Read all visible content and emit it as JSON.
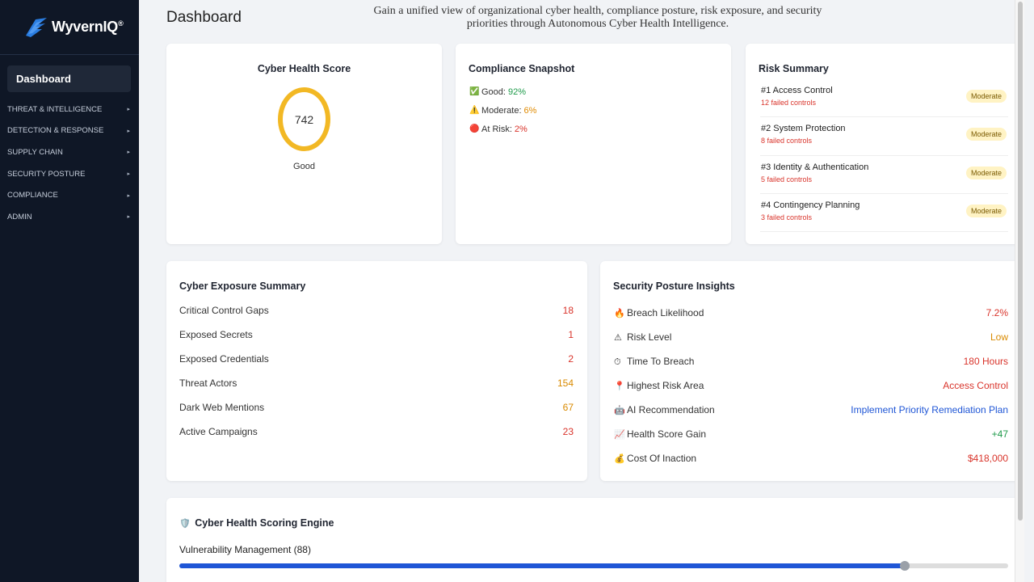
{
  "brand": {
    "name": "WyvernIQ",
    "reg": "®"
  },
  "sidebar": {
    "active": "Dashboard",
    "items": [
      {
        "label": "THREAT & INTELLIGENCE"
      },
      {
        "label": "DETECTION & RESPONSE"
      },
      {
        "label": "SUPPLY CHAIN"
      },
      {
        "label": "SECURITY POSTURE"
      },
      {
        "label": "COMPLIANCE"
      },
      {
        "label": "ADMIN"
      }
    ],
    "caret": "▸"
  },
  "header": {
    "title": "Dashboard",
    "tagline": "Gain a unified view of organizational cyber health, compliance posture, risk exposure, and security priorities through Autonomous Cyber Health Intelligence."
  },
  "health": {
    "title": "Cyber Health Score",
    "score": "742",
    "label": "Good",
    "ring_color": "#f2b824"
  },
  "compliance": {
    "title": "Compliance Snapshot",
    "rows": [
      {
        "icon": "✅",
        "label": "Good:",
        "value": "92%",
        "color": "#1e9a4a"
      },
      {
        "icon": "⚠️",
        "label": "Moderate:",
        "value": "6%",
        "color": "#e08a00"
      },
      {
        "icon": "🔴",
        "label": "At Risk:",
        "value": "2%",
        "color": "#d9342b"
      }
    ]
  },
  "risk": {
    "title": "Risk Summary",
    "items": [
      {
        "title": "#1 Access Control",
        "sub": "12 failed controls",
        "badge": "Moderate"
      },
      {
        "title": "#2 System Protection",
        "sub": "8 failed controls",
        "badge": "Moderate"
      },
      {
        "title": "#3 Identity & Authentication",
        "sub": "5 failed controls",
        "badge": "Moderate"
      },
      {
        "title": "#4 Contingency Planning",
        "sub": "3 failed controls",
        "badge": "Moderate"
      }
    ]
  },
  "exposure": {
    "title": "Cyber Exposure Summary",
    "rows": [
      {
        "label": "Critical Control Gaps",
        "value": "18",
        "color": "#d9342b"
      },
      {
        "label": "Exposed Secrets",
        "value": "1",
        "color": "#d9342b"
      },
      {
        "label": "Exposed Credentials",
        "value": "2",
        "color": "#d9342b"
      },
      {
        "label": "Threat Actors",
        "value": "154",
        "color": "#d98a00"
      },
      {
        "label": "Dark Web Mentions",
        "value": "67",
        "color": "#d98a00"
      },
      {
        "label": "Active Campaigns",
        "value": "23",
        "color": "#d9342b"
      }
    ]
  },
  "posture": {
    "title": "Security Posture Insights",
    "rows": [
      {
        "icon": "🔥",
        "label": "Breach Likelihood",
        "value": "7.2%",
        "color": "#d9342b"
      },
      {
        "icon": "⚠",
        "label": "Risk Level",
        "value": "Low",
        "color": "#d98a00"
      },
      {
        "icon": "⏱",
        "label": "Time To Breach",
        "value": "180 Hours",
        "color": "#d9342b"
      },
      {
        "icon": "📍",
        "label": "Highest Risk Area",
        "value": "Access Control",
        "color": "#d9342b"
      },
      {
        "icon": "🤖",
        "label": "AI Recommendation",
        "value": "Implement Priority Remediation Plan",
        "color": "#1f56d6"
      },
      {
        "icon": "📈",
        "label": "Health Score Gain",
        "value": "+47",
        "color": "#1e9a4a"
      },
      {
        "icon": "💰",
        "label": "Cost Of Inaction",
        "value": "$418,000",
        "color": "#d9342b"
      }
    ]
  },
  "engine": {
    "icon": "🛡️",
    "title": "Cyber Health Scoring Engine",
    "label": "Vulnerability Management (88)",
    "level": 0.875,
    "fill_color": "#1f56d6"
  }
}
